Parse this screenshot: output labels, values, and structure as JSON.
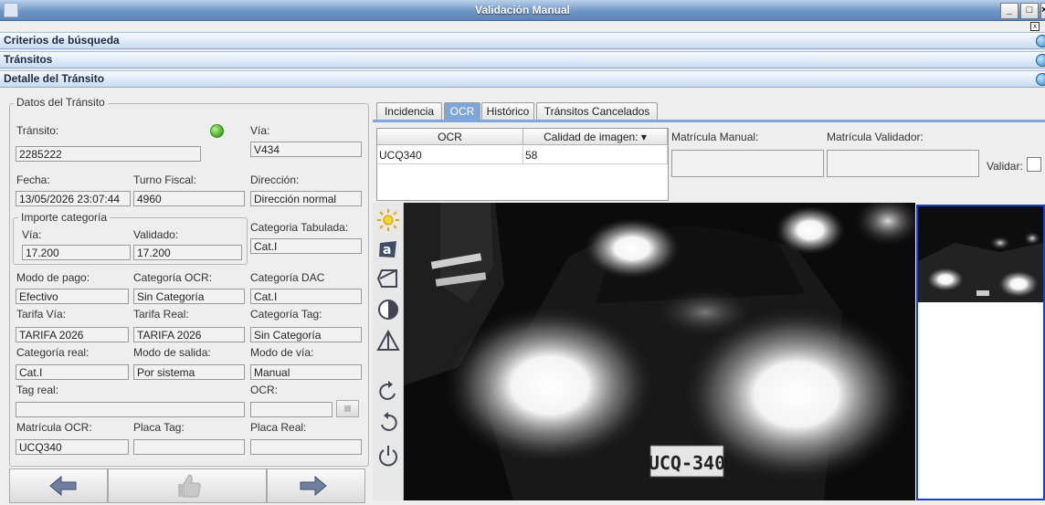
{
  "window": {
    "title": "Validación Manual",
    "minimize": "_",
    "maximize": "□",
    "close": "×",
    "inner_close": "x"
  },
  "sections": {
    "search": "Criterios de búsqueda",
    "transits": "Tránsitos",
    "detail": "Detalle del Tránsito"
  },
  "datos": {
    "legend": "Datos del Tránsito",
    "transito_label": "Tránsito:",
    "transito": "2285222",
    "via_label": "Vía:",
    "via": "V434",
    "fecha_label": "Fecha:",
    "fecha": "13/05/2026 23:07:44",
    "turno_label": "Turno Fiscal:",
    "turno": "4960",
    "direccion_label": "Dirección:",
    "direccion": "Dirección normal",
    "importe_legend": "Importe categoría",
    "importe_via_label": "Vía:",
    "importe_via": "17.200",
    "validado_label": "Validado:",
    "validado": "17.200",
    "cat_tab_label": "Categoria Tabulada:",
    "cat_tab": "Cat.I",
    "modo_pago_label": "Modo de pago:",
    "modo_pago": "Efectivo",
    "cat_ocr_label": "Categoría OCR:",
    "cat_ocr": "Sin Categoría",
    "cat_dac_label": "Categoría DAC",
    "cat_dac": "Cat.I",
    "tarifa_via_label": "Tarifa Vía:",
    "tarifa_via": "TARIFA 2026",
    "tarifa_real_label": "Tarifa Real:",
    "tarifa_real": "TARIFA 2026",
    "cat_tag_label": "Categoría Tag:",
    "cat_tag": "Sin Categoría",
    "cat_real_label": "Categoría real:",
    "cat_real": "Cat.I",
    "modo_salida_label": "Modo de salida:",
    "modo_salida": "Por sistema",
    "modo_via_label": "Modo de vía:",
    "modo_via": "Manual",
    "tag_real_label": "Tag real:",
    "tag_real": "",
    "ocr_label": "OCR:",
    "ocr": "",
    "matricula_ocr_label": "Matrícula OCR:",
    "matricula_ocr": "UCQ340",
    "placa_tag_label": "Placa Tag:",
    "placa_tag": "",
    "placa_real_label": "Placa Real:",
    "placa_real": ""
  },
  "tabs": [
    "Incidencia",
    "OCR",
    "Histórico",
    "Tránsitos Cancelados"
  ],
  "ocr_table": {
    "headers": [
      "OCR",
      "Calidad de imagen: ▾"
    ],
    "rows": [
      [
        "UCQ340",
        "58"
      ]
    ]
  },
  "matricula_manual_label": "Matrícula Manual:",
  "matricula_validador_label": "Matrícula Validador:",
  "validar_label": "Validar:",
  "plate_text": "UCQ-340",
  "colors": {
    "title_bar": "#6f95c4",
    "active_tab": "#7fa6d6",
    "thumb_border": "#1d3fcf",
    "status_led": "#4fb52a"
  }
}
